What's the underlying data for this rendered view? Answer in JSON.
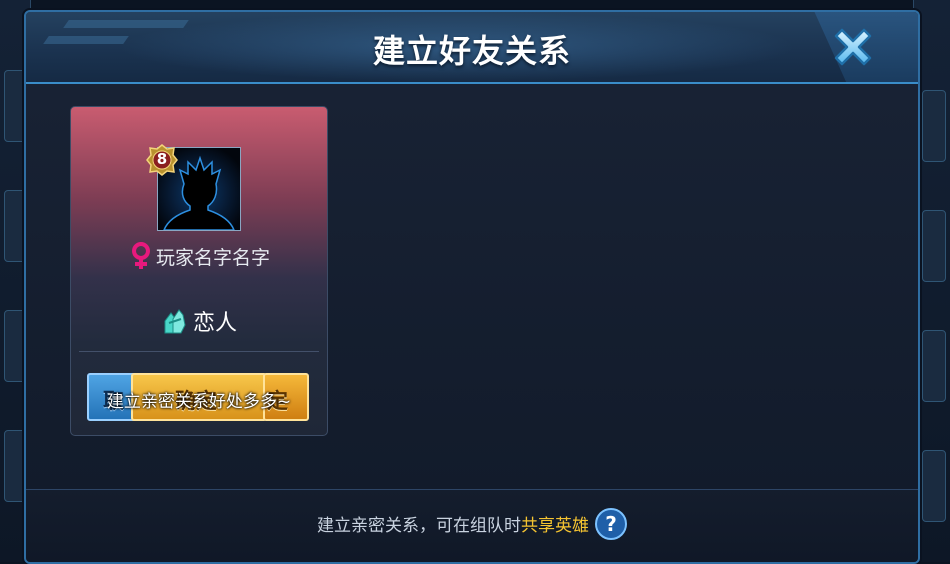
{
  "dialog": {
    "title": "建立好友关系",
    "close_icon": "close-icon"
  },
  "card": {
    "level": "8",
    "player_name": "玩家名字名字",
    "gender_icon": "female-icon",
    "relation_label": "恋人",
    "relation_icon": "couple-icon",
    "buttons": {
      "cancel_label": "取",
      "confirm_label": "确定",
      "extra_label": "定"
    },
    "overlay_hint": "建立亲密关系好处多多~"
  },
  "footer": {
    "text_prefix": "建立亲密关系，可在组队时",
    "text_highlight": "共享英雄",
    "help_icon": "help-icon"
  },
  "colors": {
    "accent": "#2f6ea3",
    "highlight": "#f5c431",
    "gold_button": "#e8a82a",
    "blue_button": "#3b8ad0",
    "card_top": "#c95c70"
  }
}
